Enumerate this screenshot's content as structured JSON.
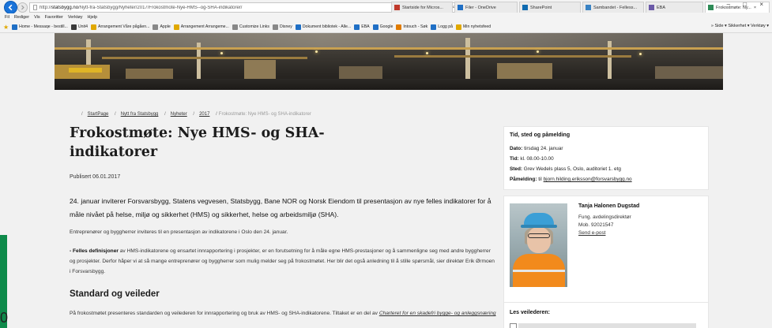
{
  "browser": {
    "url_prefix": "http://",
    "url_domain": "statsbygg.no",
    "url_path": "/Nytt-fra-Statsbygg/Nyheter/2017/Frokostmote-Nye-HMS--og-SHA-indikatorer/",
    "url_tools": "⌕ ▾ ↻",
    "tabs": [
      {
        "label": "Startside for Micros...",
        "icon_color": "#c0392b"
      },
      {
        "label": "Filer - OneDrive",
        "icon_color": "#1f6fc5"
      },
      {
        "label": "SharePoint",
        "icon_color": "#0f6ab0"
      },
      {
        "label": "Sambandet - Felless...",
        "icon_color": "#3a83c4"
      },
      {
        "label": "EBA",
        "icon_color": "#6b5aa8"
      },
      {
        "label": "Frokostmøte: Ny...",
        "icon_color": "#2e8b57",
        "active": true
      }
    ],
    "window_controls": "– □ ×",
    "menu": [
      "Fil",
      "Rediger",
      "Vis",
      "Favoritter",
      "Verktøy",
      "Hjelp"
    ],
    "favorites": [
      {
        "label": "Home - Messaqe - bestill...",
        "color": "#1f6fc5"
      },
      {
        "label": "Unit4",
        "color": "#3a3a3a"
      },
      {
        "label": "Arrangement Våre pågåen...",
        "color": "#e0a800"
      },
      {
        "label": "Apple",
        "color": "#888888"
      },
      {
        "label": "Arrangement Arrangeme...",
        "color": "#e0a800"
      },
      {
        "label": "Customize Links",
        "color": "#888888"
      },
      {
        "label": "Disney",
        "color": "#888888"
      },
      {
        "label": "Dokument bibliotek - Alle...",
        "color": "#1f6fc5"
      },
      {
        "label": "EBA",
        "color": "#1f6fc5"
      },
      {
        "label": "Google",
        "color": "#1f6fc5"
      },
      {
        "label": "Intouch - Søk",
        "color": "#e07b00"
      },
      {
        "label": "Logg på",
        "color": "#1f6fc5"
      },
      {
        "label": "Min nyhetsfeed",
        "color": "#e0a800"
      }
    ],
    "toolbar_right": "»  Side ▾  Sikkerhet ▾  Verktøy ▾"
  },
  "breadcrumb": {
    "items": [
      "StartPage",
      "Nytt fra Statsbygg",
      "Nyheter",
      "2017"
    ],
    "current": "Frokostmøte: Nye HMS- og SHA-indikatorer"
  },
  "article": {
    "title": "Frokostmøte: Nye HMS- og SHA-indikatorer",
    "published": "Publisert 06.01.2017",
    "lead": "24. januar inviterer Forsvarsbygg, Statens vegvesen, Statsbygg, Bane NOR og Norsk Eiendom til presentasjon av nye felles indikatorer for å måle nivået på helse, miljø og sikkerhet (HMS) og sikkerhet, helse og arbeidsmiljø (SHA).",
    "p1": "Entreprenører og byggherrer inviteres til en presentasjon av indikatorene i Oslo den 24. januar.",
    "p2_bold": "- Felles definisjoner",
    "p2_rest": " av HMS-indikatorene og ensartet innrapportering i prosjekter, er en forutsetning for å måle egne HMS-prestasjoner og å sammenligne seg med andre byggherrer og prosjekter. Derfor håper vi at så mange entreprenører og byggherrer som mulig melder seg på frokostmøtet. Her blir det også anledning til å stille spørsmål, sier direktør Erik Ørmoen i Forsvarsbygg.",
    "h2": "Standard og veileder",
    "p3": "På frokostmøtet presenteres standarden og veilederen for innrapportering og bruk av HMS- og SHA-indikatorene. Tiltaket er en del av ",
    "p3_link": "Charteret for en skadefri bygge- og anleggsnæring"
  },
  "event": {
    "title": "Tid, sted og påmelding",
    "date_label": "Dato:",
    "date": " tirsdag 24. januar",
    "time_label": "Tid:",
    "time": " kl. 08.00-10.00",
    "place_label": "Sted:",
    "place": " Grev Wedels plass 5, Oslo, auditoriet 1. etg",
    "signup_label": "Påmelding:",
    "signup_pre": " til ",
    "signup_email": "bjorn.hilding.eriksson@forsvarsbygg.no"
  },
  "contact": {
    "name": "Tanja Halonen Dugstad",
    "role": "Fung. avdelingsdirektør",
    "phone": "Mob. 92021547",
    "email_link": "Send e-post"
  },
  "guides": {
    "title": "Les veilederen:"
  },
  "corner_char": "0"
}
